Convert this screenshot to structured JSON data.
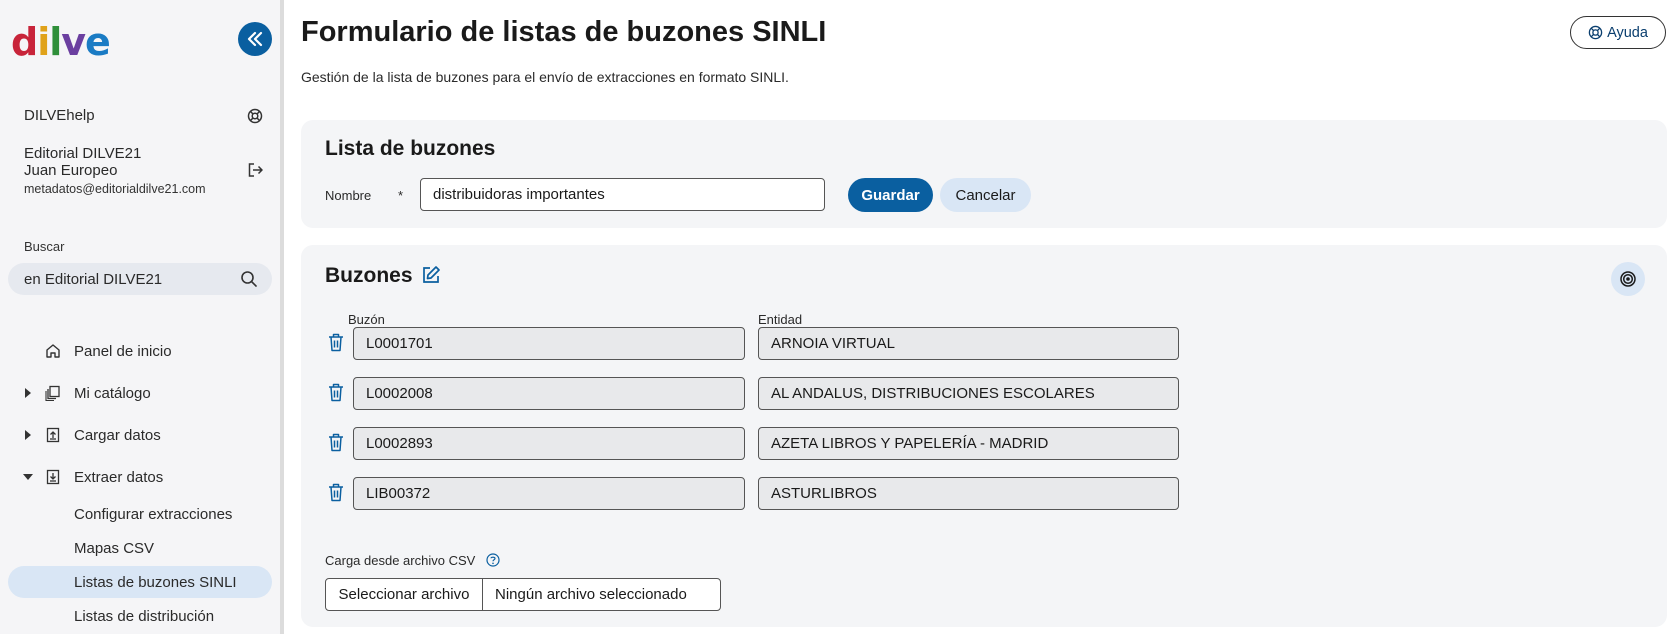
{
  "sidebar": {
    "logo": {
      "d": "d",
      "i": "i",
      "l": "l",
      "v": "v",
      "e": "e"
    },
    "help_link": "DILVEhelp",
    "user": {
      "company": "Editorial DILVE21",
      "name": "Juan Europeo",
      "email": "metadatos@editorialdilve21.com"
    },
    "search": {
      "label": "Buscar",
      "value": "en Editorial DILVE21"
    },
    "nav": [
      {
        "label": "Panel de inicio",
        "icon": "home-icon"
      },
      {
        "label": "Mi catálogo",
        "icon": "catalog-icon",
        "caret": "collapsed"
      },
      {
        "label": "Cargar datos",
        "icon": "upload-icon",
        "caret": "collapsed"
      },
      {
        "label": "Extraer datos",
        "icon": "download-icon",
        "caret": "expanded"
      }
    ],
    "subnav": [
      {
        "label": "Configurar extracciones"
      },
      {
        "label": "Mapas CSV"
      },
      {
        "label": "Listas de buzones SINLI",
        "active": true
      },
      {
        "label": "Listas de distribución"
      }
    ]
  },
  "header": {
    "title": "Formulario de listas de buzones SINLI",
    "subtitle": "Gestión de la lista de buzones para el envío de extracciones en formato SINLI.",
    "help_button": "Ayuda"
  },
  "list_card": {
    "title": "Lista de buzones",
    "name_label": "Nombre",
    "required_mark": "*",
    "name_value": "distribuidoras importantes",
    "save_button": "Guardar",
    "cancel_button": "Cancelar"
  },
  "mailboxes_card": {
    "title": "Buzones",
    "col_mailbox": "Buzón",
    "col_entity": "Entidad",
    "rows": [
      {
        "mailbox": "L0001701",
        "entity": "ARNOIA VIRTUAL"
      },
      {
        "mailbox": "L0002008",
        "entity": "AL ANDALUS, DISTRIBUCIONES ESCOLARES"
      },
      {
        "mailbox": "L0002893",
        "entity": "AZETA LIBROS Y PAPELERÍA - MADRID"
      },
      {
        "mailbox": "LIB00372",
        "entity": "ASTURLIBROS"
      }
    ],
    "csv_label": "Carga desde archivo CSV",
    "file_button": "Seleccionar archivo",
    "file_status": "Ningún archivo seleccionado"
  },
  "colors": {
    "accent": "#0a5fa0",
    "accent_light": "#d9e6f5",
    "sidebar_bg": "#f5f5f7",
    "card_bg": "#f4f5f7"
  }
}
